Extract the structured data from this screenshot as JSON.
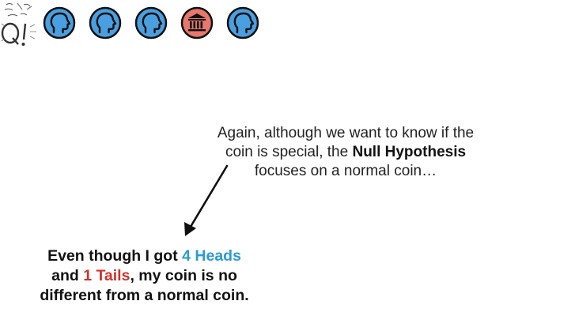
{
  "logo": {
    "text": "Q!"
  },
  "coins": [
    {
      "icon": "head-profile-icon",
      "fill": "#4a9fe0"
    },
    {
      "icon": "head-profile-icon",
      "fill": "#4a9fe0"
    },
    {
      "icon": "head-profile-icon",
      "fill": "#4a9fe0"
    },
    {
      "icon": "bank-building-icon",
      "fill": "#e8776c"
    },
    {
      "icon": "head-profile-icon",
      "fill": "#4a9fe0"
    }
  ],
  "annotation": {
    "line1": "Again, although we want to know if the",
    "line2_pre": "coin is special, the ",
    "line2_bold": "Null Hypothesis",
    "line3": "focuses on a normal coin…"
  },
  "statement": {
    "pre": "Even though I got ",
    "heads": "4 Heads",
    "mid": "and ",
    "tails": "1 Tails",
    "post": ", my coin is no",
    "line3": "different from a normal coin."
  },
  "colors": {
    "heads": "#2a9ad8",
    "tails": "#d2312a",
    "coin_blue": "#4a9fe0",
    "coin_red": "#e8776c"
  }
}
